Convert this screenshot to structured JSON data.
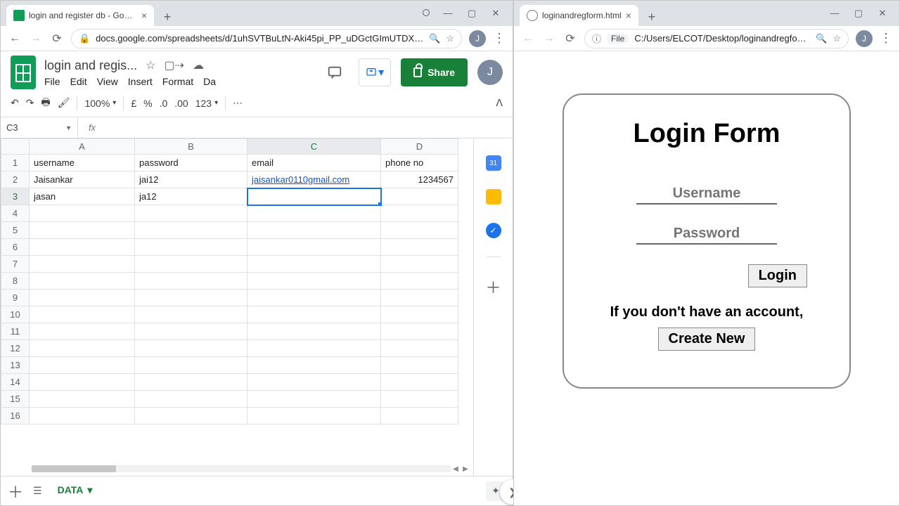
{
  "leftWindow": {
    "tabTitle": "login and register db - Google S",
    "url": "docs.google.com/spreadsheets/d/1uhSVTBuLtN-Aki45pi_PP_uDGctGImUTDX…",
    "avatarLetter": "J",
    "doc": {
      "title": "login and regis...",
      "menus": [
        "File",
        "Edit",
        "View",
        "Insert",
        "Format",
        "Da"
      ],
      "shareLabel": "Share",
      "zoom": "100%",
      "currency": "£",
      "percent": "%",
      "dec1": ".0",
      "dec2": ".00",
      "numfmt": "123",
      "nameBox": "C3",
      "fxLabel": "fx",
      "columns": [
        "A",
        "B",
        "C",
        "D"
      ],
      "rowsShown": 16,
      "headerRow": [
        "username",
        "password",
        "email",
        "phone no"
      ],
      "dataRows": [
        [
          "Jaisankar",
          "jai12",
          "jaisankar0110gmail.com",
          "1234567"
        ],
        [
          "jasan",
          "ja12",
          "",
          ""
        ]
      ],
      "activeSheet": "DATA"
    }
  },
  "rightWindow": {
    "tabTitle": "loginandregform.html",
    "fileChip": "File",
    "url": "C:/Users/ELCOT/Desktop/loginandregfo…",
    "avatarLetter": "J",
    "form": {
      "heading": "Login Form",
      "usernamePlaceholder": "Username",
      "passwordPlaceholder": "Password",
      "loginLabel": "Login",
      "hint": "If you don't have an account,",
      "createLabel": "Create New"
    }
  }
}
